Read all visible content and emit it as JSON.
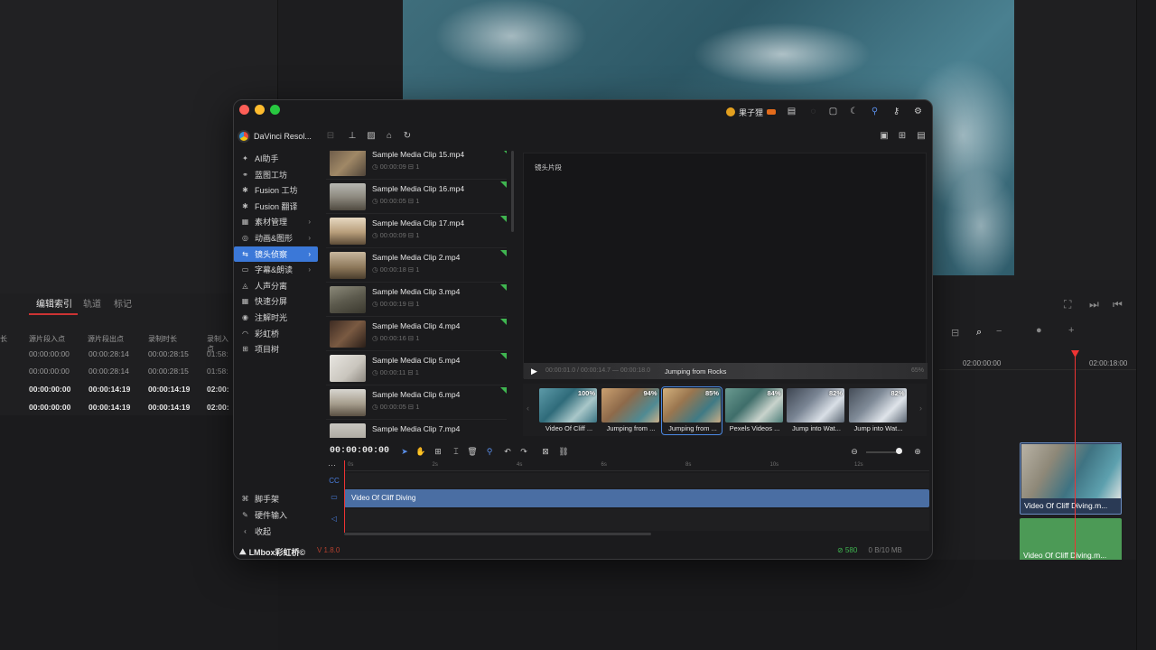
{
  "background": {
    "index_tabs": [
      "编辑索引",
      "轨道",
      "标记"
    ],
    "table_headers": [
      "长",
      "源片段入点",
      "源片段出点",
      "录制时长",
      "录制入点"
    ],
    "table_rows": [
      {
        "c1": "00:00:00:00",
        "c2": "00:00:28:14",
        "c3": "00:00:28:15",
        "c4": "01:58:",
        "bold": false
      },
      {
        "c1": "00:00:00:00",
        "c2": "00:00:28:14",
        "c3": "00:00:28:15",
        "c4": "01:58:",
        "bold": false
      },
      {
        "c1": "00:00:00:00",
        "c2": "00:00:14:19",
        "c3": "00:00:14:19",
        "c4": "02:00:",
        "bold": true
      },
      {
        "c1": "00:00:00:00",
        "c2": "00:00:14:19",
        "c3": "00:00:14:19",
        "c4": "02:00:",
        "bold": true
      }
    ],
    "ruler_ticks": [
      "02:00:00:00",
      "02:00:18:00"
    ],
    "video_clip_label": "Video Of Cliff Diving.m...",
    "audio_clip_label": "Video Of Cliff Diving.m..."
  },
  "window": {
    "user_name": "果子狸",
    "app_name": "DaVinci Resol...",
    "nav": [
      {
        "icon": "ai-icon",
        "glyph": "✦",
        "label": "AI助手",
        "chevron": false,
        "active": false
      },
      {
        "icon": "blueprint-icon",
        "glyph": "⚭",
        "label": "蓝图工坊",
        "chevron": false,
        "active": false
      },
      {
        "icon": "fusion-icon",
        "glyph": "✱",
        "label": "Fusion 工坊",
        "chevron": false,
        "active": false
      },
      {
        "icon": "translate-icon",
        "glyph": "✱",
        "label": "Fusion 翻译",
        "chevron": false,
        "active": false
      },
      {
        "icon": "media-icon",
        "glyph": "▦",
        "label": "素材管理",
        "chevron": true,
        "active": false
      },
      {
        "icon": "animation-icon",
        "glyph": "◎",
        "label": "动画&图形",
        "chevron": true,
        "active": false
      },
      {
        "icon": "shot-detect-icon",
        "glyph": "⇆",
        "label": "镜头侦察",
        "chevron": true,
        "active": true
      },
      {
        "icon": "subtitle-icon",
        "glyph": "▭",
        "label": "字幕&朗读",
        "chevron": true,
        "active": false
      },
      {
        "icon": "voice-separate-icon",
        "glyph": "◬",
        "label": "人声分离",
        "chevron": false,
        "active": false
      },
      {
        "icon": "split-screen-icon",
        "glyph": "▦",
        "label": "快速分屏",
        "chevron": false,
        "active": false
      },
      {
        "icon": "annotate-icon",
        "glyph": "◉",
        "label": "注解时光",
        "chevron": false,
        "active": false
      },
      {
        "icon": "rainbow-icon",
        "glyph": "◠",
        "label": "彩虹桥",
        "chevron": false,
        "active": false
      },
      {
        "icon": "project-tree-icon",
        "glyph": "⊞",
        "label": "项目树",
        "chevron": false,
        "active": false
      }
    ],
    "nav_bottom": [
      {
        "icon": "scaffold-icon",
        "glyph": "⌘",
        "label": "脚手架"
      },
      {
        "icon": "hardware-input-icon",
        "glyph": "✎",
        "label": "硬件输入"
      },
      {
        "icon": "collapse-icon",
        "glyph": "‹",
        "label": "收起"
      }
    ],
    "brand": "LMbox彩虹桥©",
    "version": "V 1.8.0",
    "clips": [
      {
        "name": "Sample Media Clip 15.mp4",
        "duration": "00:00:09",
        "count": "1",
        "thumb": "linear-gradient(135deg,#6b5a48,#a08866 50%,#50453a)"
      },
      {
        "name": "Sample Media Clip 16.mp4",
        "duration": "00:00:05",
        "count": "1",
        "thumb": "linear-gradient(180deg,#b7b7b2 0%,#8e8a80 50%,#4f4a40 100%)"
      },
      {
        "name": "Sample Media Clip 17.mp4",
        "duration": "00:00:09",
        "count": "1",
        "thumb": "linear-gradient(180deg,#e7d9c2 0%,#b79d7a 55%,#5d4c38 100%)"
      },
      {
        "name": "Sample Media Clip 2.mp4",
        "duration": "00:00:18",
        "count": "1",
        "thumb": "linear-gradient(180deg,#c8b79e 0%,#8a7557 60%,#4a3d2d 100%)"
      },
      {
        "name": "Sample Media Clip 3.mp4",
        "duration": "00:00:19",
        "count": "1",
        "thumb": "linear-gradient(160deg,#8c8a7a 0%,#5c5a4d 50%,#3a382e 100%)"
      },
      {
        "name": "Sample Media Clip 4.mp4",
        "duration": "00:00:16",
        "count": "1",
        "thumb": "linear-gradient(135deg,#3d2b22 0%,#7a5a42 50%,#2a1e18 100%)"
      },
      {
        "name": "Sample Media Clip 5.mp4",
        "duration": "00:00:11",
        "count": "1",
        "thumb": "linear-gradient(135deg,#e8e6e1 0%,#c9c5bd 60%,#8d8880 100%)"
      },
      {
        "name": "Sample Media Clip 6.mp4",
        "duration": "00:00:05",
        "count": "1",
        "thumb": "linear-gradient(180deg,#d8d6d0 0%,#a59c8c 55%,#5a5043 100%)"
      },
      {
        "name": "Sample Media Clip 7.mp4",
        "duration": "",
        "count": "",
        "thumb": "linear-gradient(180deg,#c8c6c0 0%,#9a948a 100%)"
      }
    ],
    "preview": {
      "label": "镜头片段",
      "time": "00:00:01.0 / 00:00:14.7 — 00:00:18.0",
      "title": "Jumping from Rocks",
      "pct": "65%"
    },
    "matches": [
      {
        "name": "Video Of Cliff ...",
        "pct": "100%",
        "selected": false,
        "thumb": "linear-gradient(135deg,#5d9aa8 0%,#2f6b7a 40%,#a9c7c9 70%,#3b7584 100%)"
      },
      {
        "name": "Jumping from ...",
        "pct": "94%",
        "selected": false,
        "thumb": "linear-gradient(135deg,#caa070 0%,#8e6a4a 40%,#4f8a93 75%,#c9b08a 100%)"
      },
      {
        "name": "Jumping from ...",
        "pct": "85%",
        "selected": true,
        "thumb": "linear-gradient(135deg,#d2b07c 0%,#9a764f 35%,#3f7a85 70%,#c8ad86 100%)"
      },
      {
        "name": "Pexels Videos ...",
        "pct": "84%",
        "selected": false,
        "thumb": "linear-gradient(135deg,#6a9a90 0%,#3f6e6a 40%,#c9d3cc 70%,#4d7f7a 100%)"
      },
      {
        "name": "Jump into Wat...",
        "pct": "82%",
        "selected": false,
        "thumb": "linear-gradient(135deg,#3e4652 0%,#7a8594 40%,#d9dfe6 70%,#5a6572 100%)"
      },
      {
        "name": "Jump into Wat...",
        "pct": "82%",
        "selected": false,
        "thumb": "linear-gradient(135deg,#454d58 0%,#808b98 40%,#dfe4ea 70%,#5e6976 100%)"
      }
    ],
    "timeline": {
      "timecode": "00:00:00:00",
      "ticks": [
        "0s",
        "2s",
        "4s",
        "6s",
        "8s",
        "10s",
        "12s"
      ],
      "video_label": "Video Of Cliff Diving"
    },
    "footer": {
      "count": "⊘ 580",
      "size": "0 B/10 MB"
    }
  }
}
